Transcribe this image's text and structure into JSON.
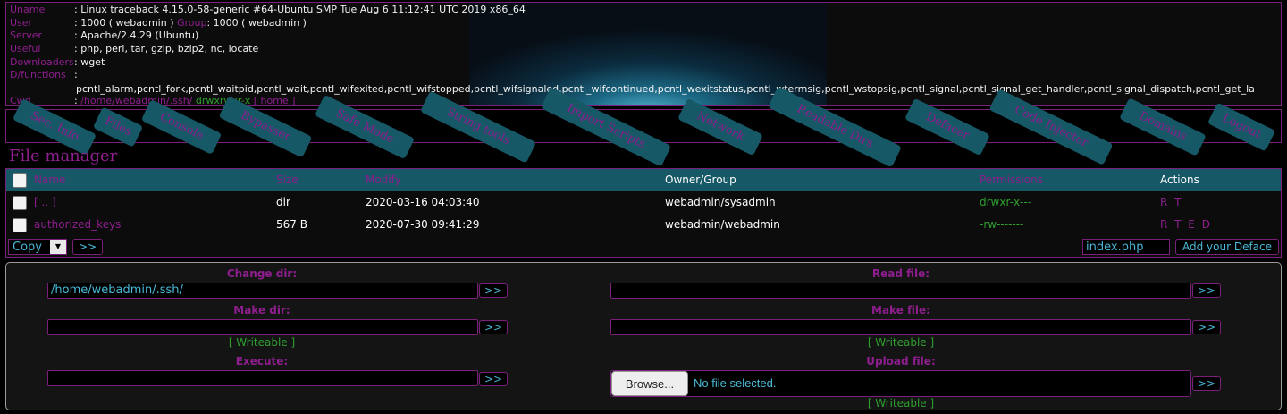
{
  "info": {
    "uname_label": "Uname",
    "uname_value": ": Linux traceback 4.15.0-58-generic #64-Ubuntu SMP Tue Aug 6 11:12:41 UTC 2019 x86_64",
    "user_label": "User",
    "user_value": ": 1000 ( webadmin )",
    "group_label": "Group",
    "group_value": ": 1000 ( webadmin )",
    "server_label": "Server",
    "server_value": ": Apache/2.4.29 (Ubuntu)",
    "useful_label": "Useful",
    "useful_value": ": php, perl, tar, gzip, bzip2, nc, locate",
    "downloaders_label": "Downloaders",
    "downloaders_value": ": wget",
    "dfunctions_label": "D/functions",
    "dfunctions_sep": ":",
    "dfunctions_value": "pcntl_alarm,pcntl_fork,pcntl_waitpid,pcntl_wait,pcntl_wifexited,pcntl_wifstopped,pcntl_wifsignaled,pcntl_wifcontinued,pcntl_wexitstatus,pcntl_wtermsig,pcntl_wstopsig,pcntl_signal,pcntl_signal_get_handler,pcntl_signal_dispatch,pcntl_get_la",
    "cwd_label": "Cwd",
    "cwd_sep": ":",
    "cwd_path": "/home/webadmin/.ssh/",
    "cwd_perms": "drwxrwxr-x",
    "cwd_home": "[ home ]"
  },
  "nav": {
    "items": [
      "Sec. Info",
      "Files",
      "Console",
      "Bypasser",
      "Safe Mode",
      "String tools",
      "Import Scripts",
      "Network",
      "Readable Dirs",
      "Defacer",
      "Code Injector",
      "Domains",
      "Logout"
    ]
  },
  "file_manager": {
    "title": "File manager",
    "columns": [
      "Name",
      "Size",
      "Modify",
      "Owner/Group",
      "Permissions",
      "Actions"
    ],
    "rows": [
      {
        "name": "[ .. ]",
        "size": "dir",
        "modify": "2020-03-16 04:03:40",
        "owner": "webadmin/sysadmin",
        "perms": "drwxr-x---",
        "actions": "R T"
      },
      {
        "name": "authorized_keys",
        "size": "567 B",
        "modify": "2020-07-30 09:41:29",
        "owner": "webadmin/webadmin",
        "perms": "-rw-------",
        "actions": "R T E D"
      }
    ],
    "action_select": "Copy",
    "go_label": ">>",
    "deface_filename": "index.php",
    "deface_button": "Add your Deface"
  },
  "tools": {
    "change_dir_label": "Change dir:",
    "change_dir_value": "/home/webadmin/.ssh/",
    "read_file_label": "Read file:",
    "make_dir_label": "Make dir:",
    "make_file_label": "Make file:",
    "writeable": "[ Writeable ]",
    "execute_label": "Execute:",
    "upload_label": "Upload file:",
    "browse_label": "Browse...",
    "no_file": "No file selected.",
    "go_label": ">>"
  },
  "colors": {
    "accent_magenta": "#8e1e8e",
    "teal": "#165866",
    "green": "#2ea02e",
    "input_text": "#4ab8d6"
  }
}
